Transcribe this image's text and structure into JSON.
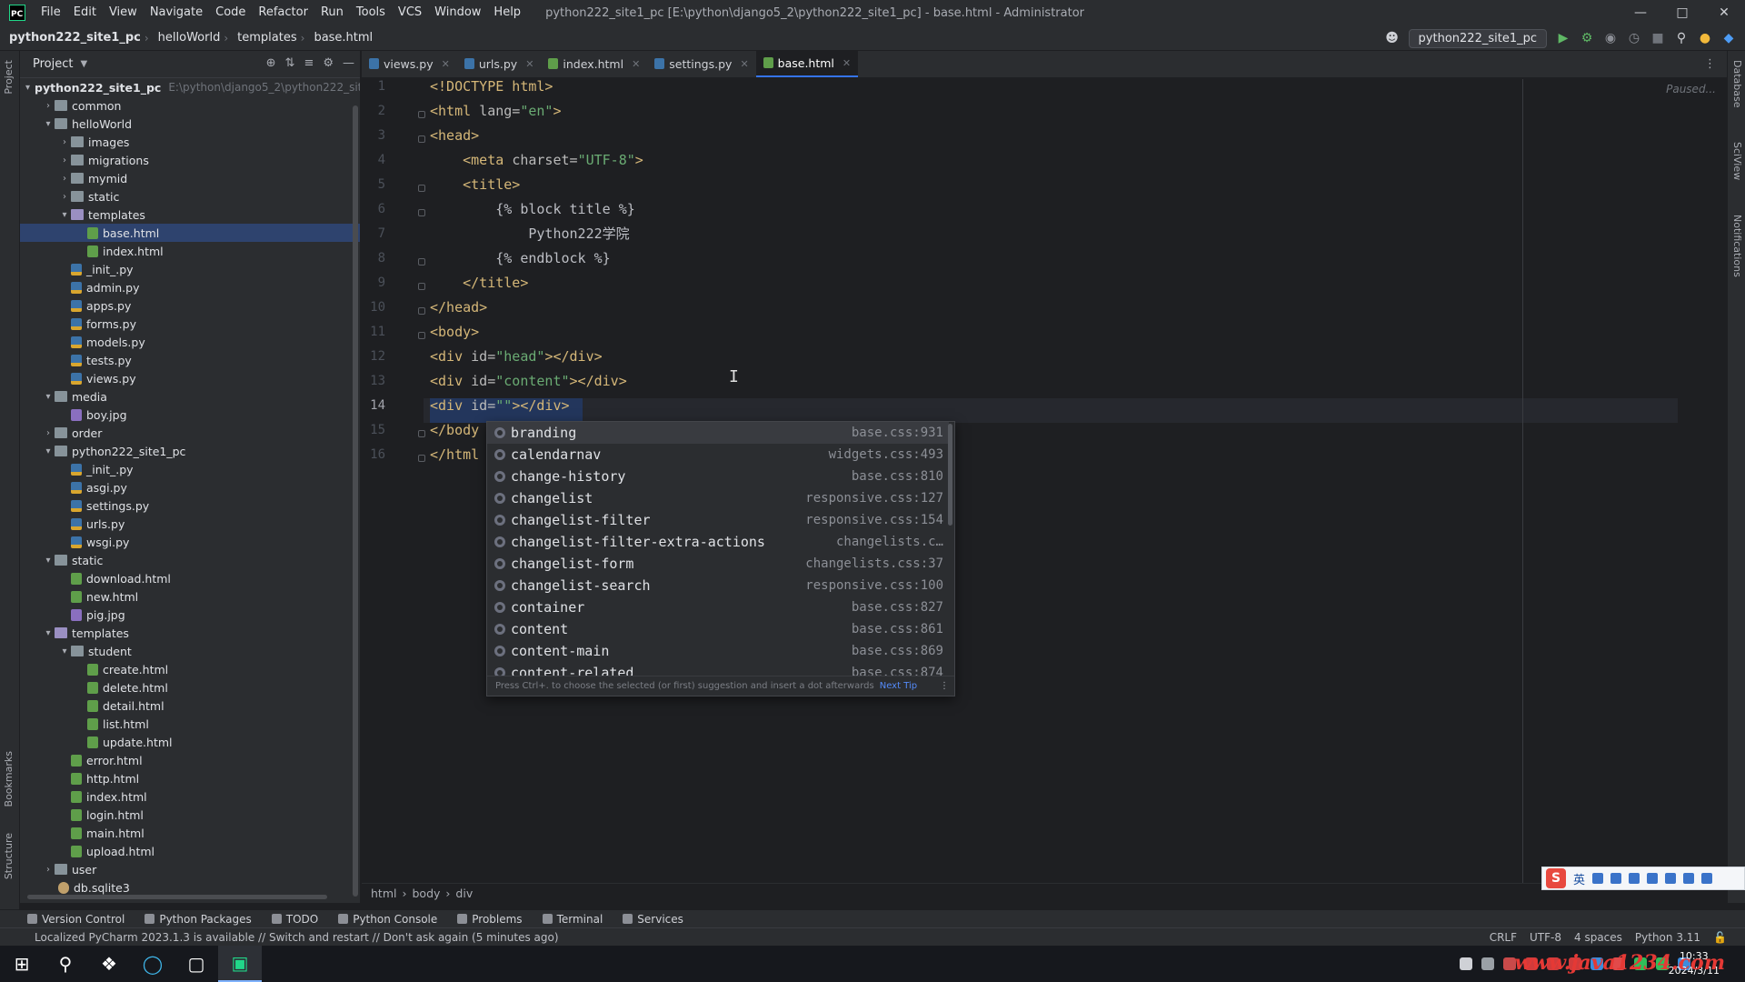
{
  "titlebar": {
    "menus": [
      "File",
      "Edit",
      "View",
      "Navigate",
      "Code",
      "Refactor",
      "Run",
      "Tools",
      "VCS",
      "Window",
      "Help"
    ],
    "title": "python222_site1_pc [E:\\python\\django5_2\\python222_site1_pc] - base.html - Administrator"
  },
  "navbar": {
    "crumbs": [
      "python222_site1_pc",
      "helloWorld",
      "templates",
      "base.html"
    ],
    "run_config": "python222_site1_pc"
  },
  "project": {
    "title": "Project",
    "root_path": "E:\\python\\django5_2\\python222_sit",
    "items": [
      {
        "label": "python222_site1_pc",
        "bold": true
      },
      {
        "label": "common"
      },
      {
        "label": "helloWorld"
      },
      {
        "label": "images"
      },
      {
        "label": "migrations"
      },
      {
        "label": "mymid"
      },
      {
        "label": "static"
      },
      {
        "label": "templates"
      },
      {
        "label": "base.html"
      },
      {
        "label": "index.html"
      },
      {
        "label": "_init_.py"
      },
      {
        "label": "admin.py"
      },
      {
        "label": "apps.py"
      },
      {
        "label": "forms.py"
      },
      {
        "label": "models.py"
      },
      {
        "label": "tests.py"
      },
      {
        "label": "views.py"
      },
      {
        "label": "media"
      },
      {
        "label": "boy.jpg"
      },
      {
        "label": "order"
      },
      {
        "label": "python222_site1_pc"
      },
      {
        "label": "_init_.py"
      },
      {
        "label": "asgi.py"
      },
      {
        "label": "settings.py"
      },
      {
        "label": "urls.py"
      },
      {
        "label": "wsgi.py"
      },
      {
        "label": "static"
      },
      {
        "label": "download.html"
      },
      {
        "label": "new.html"
      },
      {
        "label": "pig.jpg"
      },
      {
        "label": "templates"
      },
      {
        "label": "student"
      },
      {
        "label": "create.html"
      },
      {
        "label": "delete.html"
      },
      {
        "label": "detail.html"
      },
      {
        "label": "list.html"
      },
      {
        "label": "update.html"
      },
      {
        "label": "error.html"
      },
      {
        "label": "http.html"
      },
      {
        "label": "index.html"
      },
      {
        "label": "login.html"
      },
      {
        "label": "main.html"
      },
      {
        "label": "upload.html"
      },
      {
        "label": "user"
      },
      {
        "label": "db.sqlite3"
      }
    ]
  },
  "tabs": [
    {
      "label": "views.py"
    },
    {
      "label": "urls.py"
    },
    {
      "label": "index.html"
    },
    {
      "label": "settings.py"
    },
    {
      "label": "base.html",
      "active": true
    }
  ],
  "editor": {
    "paused": "Paused...",
    "line_numbers": [
      "1",
      "2",
      "3",
      "4",
      "5",
      "6",
      "7",
      "8",
      "9",
      "10",
      "11",
      "12",
      "13",
      "14",
      "15",
      "16"
    ],
    "lines": {
      "l1": "<!DOCTYPE html>",
      "l2_open": "<html ",
      "l2_attr": "lang=",
      "l2_str": "\"en\"",
      "l2_close": ">",
      "l3": "<head>",
      "l4_open": "    <meta ",
      "l4_attr": "charset=",
      "l4_str": "\"UTF-8\"",
      "l4_close": ">",
      "l5": "    <title>",
      "l6": "        {% block title %}",
      "l7": "            Python222学院",
      "l8": "        {% endblock %}",
      "l9": "    </title>",
      "l10": "</head>",
      "l11": "<body>",
      "l12_open": "<div ",
      "l12_attr": "id=",
      "l12_str": "\"head\"",
      "l12_close": "></div>",
      "l13_open": "<div ",
      "l13_attr": "id=",
      "l13_str": "\"content\"",
      "l13_close": "></div>",
      "l14_open": "<div ",
      "l14_attr": "id=",
      "l14_str": "\"\"",
      "l14_close": "></div>",
      "l15": "</body",
      "l16": "</html"
    },
    "breadcrumb": [
      "html",
      "body",
      "div"
    ]
  },
  "completion": {
    "items": [
      {
        "label": "branding",
        "source": "base.css:931"
      },
      {
        "label": "calendarnav",
        "source": "widgets.css:493"
      },
      {
        "label": "change-history",
        "source": "base.css:810"
      },
      {
        "label": "changelist",
        "source": "responsive.css:127"
      },
      {
        "label": "changelist-filter",
        "source": "responsive.css:154"
      },
      {
        "label": "changelist-filter-extra-actions",
        "source": "changelists.c…"
      },
      {
        "label": "changelist-form",
        "source": "changelists.css:37"
      },
      {
        "label": "changelist-search",
        "source": "responsive.css:100"
      },
      {
        "label": "container",
        "source": "base.css:827"
      },
      {
        "label": "content",
        "source": "base.css:861"
      },
      {
        "label": "content-main",
        "source": "base.css:869"
      },
      {
        "label": "content-related",
        "source": "base.css:874"
      }
    ],
    "footer": "Press Ctrl+. to choose the selected (or first) suggestion and insert a dot afterwards",
    "next_tip": "Next Tip"
  },
  "toolwindows": [
    "Version Control",
    "Python Packages",
    "TODO",
    "Python Console",
    "Problems",
    "Terminal",
    "Services"
  ],
  "statusbar": {
    "message": "Localized PyCharm 2023.1.3 is available // Switch and restart // Don't ask again (5 minutes ago)",
    "line_sep": "CRLF",
    "encoding": "UTF-8",
    "indent": "4 spaces",
    "interpreter": "Python 3.11"
  },
  "taskbar": {
    "time": "10:33",
    "date": "2024/3/11",
    "watermark": "www.java1234.com"
  },
  "ime": {
    "lang": "英"
  }
}
